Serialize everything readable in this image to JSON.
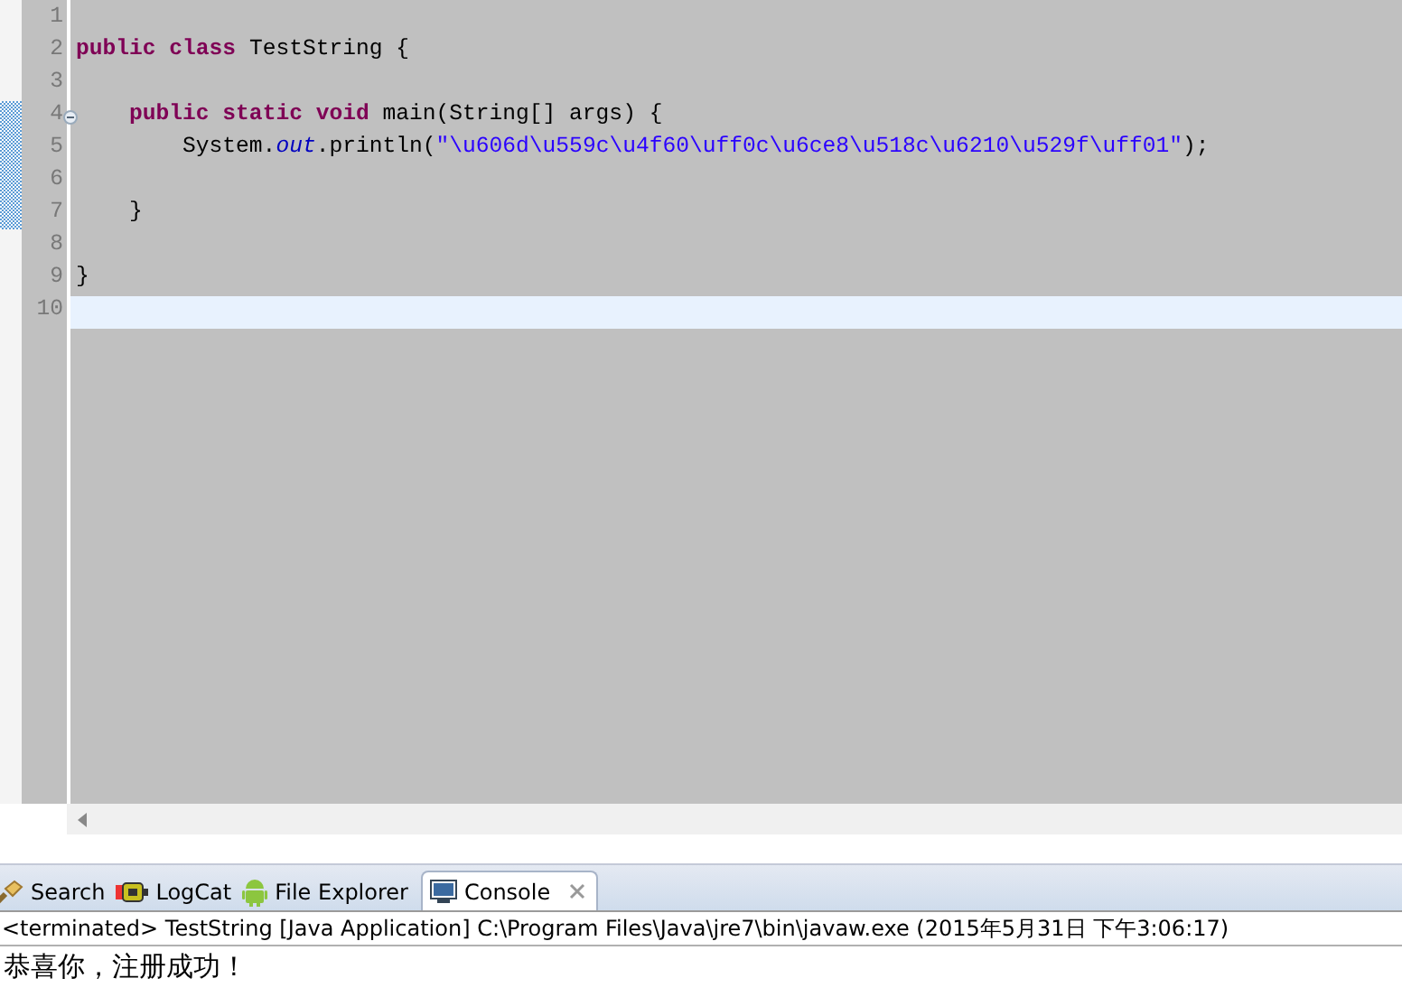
{
  "editor": {
    "lines": [
      {
        "number": "1",
        "current": false,
        "fold": false
      },
      {
        "number": "2",
        "current": false,
        "fold": false,
        "tokens": [
          {
            "kind": "keyword",
            "text": "public"
          },
          {
            "kind": "keyword",
            "text": " class"
          },
          {
            "kind": "plain",
            "text": " TestString {"
          }
        ]
      },
      {
        "number": "3",
        "current": false,
        "fold": false
      },
      {
        "number": "4",
        "current": false,
        "fold": true,
        "tokens": [
          {
            "kind": "keyword",
            "text": "    public"
          },
          {
            "kind": "keyword",
            "text": " static"
          },
          {
            "kind": "keyword",
            "text": " void"
          },
          {
            "kind": "plain",
            "text": " main(String[] args) {"
          }
        ]
      },
      {
        "number": "5",
        "current": false,
        "fold": false,
        "tokens": [
          {
            "kind": "plain",
            "text": "        System."
          },
          {
            "kind": "field",
            "text": "out"
          },
          {
            "kind": "plain",
            "text": ".println("
          },
          {
            "kind": "string",
            "text": "\"\\u606d\\u559c\\u4f60\\uff0c\\u6ce8\\u518c\\u6210\\u529f\\uff01\""
          },
          {
            "kind": "plain",
            "text": ");"
          }
        ]
      },
      {
        "number": "6",
        "current": false,
        "fold": false
      },
      {
        "number": "7",
        "current": false,
        "fold": false,
        "tokens": [
          {
            "kind": "plain",
            "text": "    }"
          }
        ]
      },
      {
        "number": "8",
        "current": false,
        "fold": false
      },
      {
        "number": "9",
        "current": false,
        "fold": false,
        "tokens": [
          {
            "kind": "plain",
            "text": "}"
          }
        ]
      },
      {
        "number": "10",
        "current": true,
        "fold": false
      }
    ]
  },
  "tabs": [
    {
      "label": "Search",
      "selected": false,
      "closable": false
    },
    {
      "label": "LogCat",
      "selected": false,
      "closable": false
    },
    {
      "label": "File Explorer",
      "selected": false,
      "closable": false
    },
    {
      "label": "Console",
      "selected": true,
      "closable": true
    }
  ],
  "console": {
    "status": "<terminated> TestString [Java Application] C:\\Program Files\\Java\\jre7\\bin\\javaw.exe (2015年5月31日 下午3:06:17)",
    "output": [
      "恭喜你，注册成功！"
    ]
  }
}
